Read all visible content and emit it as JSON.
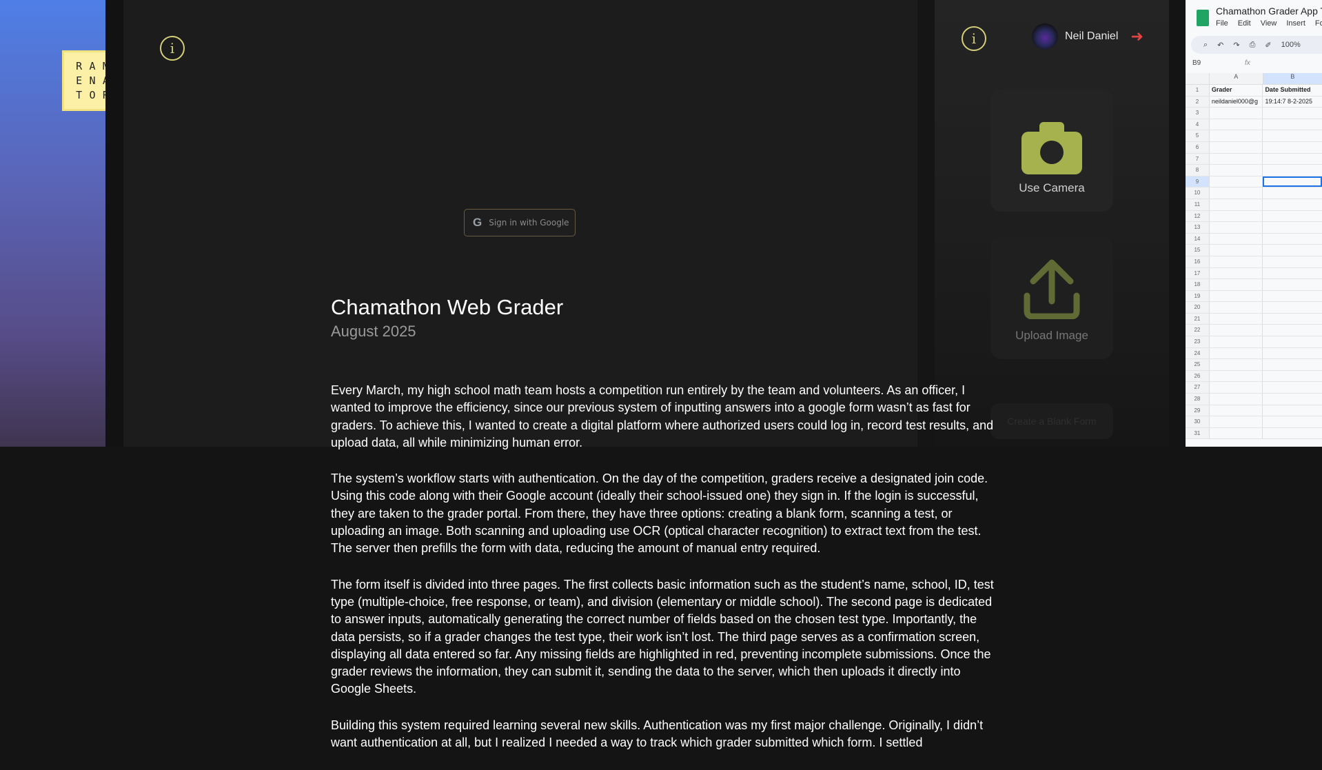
{
  "logo": {
    "letters": [
      "R",
      "A",
      "M",
      "E",
      "N",
      "A",
      "T",
      "O",
      "R"
    ]
  },
  "main_panel": {
    "info_icon": "info-icon",
    "signin_label": "Sign in with Google",
    "google_icon": "G"
  },
  "app_panel": {
    "user_name": "Neil Daniel",
    "logout_icon": "logout-icon",
    "use_camera_label": "Use Camera",
    "upload_image_label": "Upload Image",
    "blank_form_label": "Create a Blank Form"
  },
  "sheet": {
    "title": "Chamathon Grader App T",
    "menu": [
      "File",
      "Edit",
      "View",
      "Insert",
      "Form"
    ],
    "zoom": "100%",
    "namebox": "B9",
    "fx": "fx",
    "col_a": "A",
    "col_b": "B",
    "rows": [
      {
        "n": "1",
        "a": "Grader",
        "b": "Date Submitted"
      },
      {
        "n": "2",
        "a": "neildaniel000@g",
        "b": "19:14:7 8-2-2025"
      },
      {
        "n": "3",
        "a": "",
        "b": ""
      },
      {
        "n": "4",
        "a": "",
        "b": ""
      },
      {
        "n": "5",
        "a": "",
        "b": ""
      },
      {
        "n": "6",
        "a": "",
        "b": ""
      },
      {
        "n": "7",
        "a": "",
        "b": ""
      },
      {
        "n": "8",
        "a": "",
        "b": ""
      },
      {
        "n": "9",
        "a": "",
        "b": ""
      },
      {
        "n": "10",
        "a": "",
        "b": ""
      },
      {
        "n": "11",
        "a": "",
        "b": ""
      },
      {
        "n": "12",
        "a": "",
        "b": ""
      },
      {
        "n": "13",
        "a": "",
        "b": ""
      },
      {
        "n": "14",
        "a": "",
        "b": ""
      },
      {
        "n": "15",
        "a": "",
        "b": ""
      },
      {
        "n": "16",
        "a": "",
        "b": ""
      },
      {
        "n": "17",
        "a": "",
        "b": ""
      },
      {
        "n": "18",
        "a": "",
        "b": ""
      },
      {
        "n": "19",
        "a": "",
        "b": ""
      },
      {
        "n": "20",
        "a": "",
        "b": ""
      },
      {
        "n": "21",
        "a": "",
        "b": ""
      },
      {
        "n": "22",
        "a": "",
        "b": ""
      },
      {
        "n": "23",
        "a": "",
        "b": ""
      },
      {
        "n": "24",
        "a": "",
        "b": ""
      },
      {
        "n": "25",
        "a": "",
        "b": ""
      },
      {
        "n": "26",
        "a": "",
        "b": ""
      },
      {
        "n": "27",
        "a": "",
        "b": ""
      },
      {
        "n": "28",
        "a": "",
        "b": ""
      },
      {
        "n": "29",
        "a": "",
        "b": ""
      },
      {
        "n": "30",
        "a": "",
        "b": ""
      },
      {
        "n": "31",
        "a": "",
        "b": ""
      }
    ]
  },
  "article": {
    "title": "Chamathon Web Grader",
    "date": "August 2025",
    "paragraphs": [
      "Every March, my high school math team hosts a competition run entirely by the team and volunteers. As an officer, I wanted to improve the efficiency, since our previous system of inputting answers into a google form wasn’t as fast for graders. To achieve this, I wanted to create a digital platform where authorized users could log in, record test results, and upload data, all while minimizing human error.",
      "The system’s workflow starts with authentication. On the day of the competition, graders receive a designated join code. Using this code along with their Google account (ideally their school-issued one) they sign in. If the login is successful, they are taken to the grader portal. From there, they have three options: creating a blank form, scanning a test, or uploading an image. Both scanning and uploading use OCR (optical character recognition) to extract text from the test. The server then prefills the form with data, reducing the amount of manual entry required.",
      "The form itself is divided into three pages. The first collects basic information such as the student’s name, school, ID, test type (multiple-choice, free response, or team), and division (elementary or middle school). The second page is dedicated to answer inputs, automatically generating the correct number of fields based on the chosen test type. Importantly, the data persists, so if a grader changes the test type, their work isn’t lost. The third page serves as a confirmation screen, displaying all data entered so far. Any missing fields are highlighted in red, preventing incomplete submissions. Once the grader reviews the information, they can submit it, sending the data to the server, which then uploads it directly into Google Sheets.",
      "Building this system required learning several new skills. Authentication was my first major challenge. Originally, I didn’t want authentication at all, but I realized I needed a way to track which grader submitted which form. I settled"
    ]
  }
}
